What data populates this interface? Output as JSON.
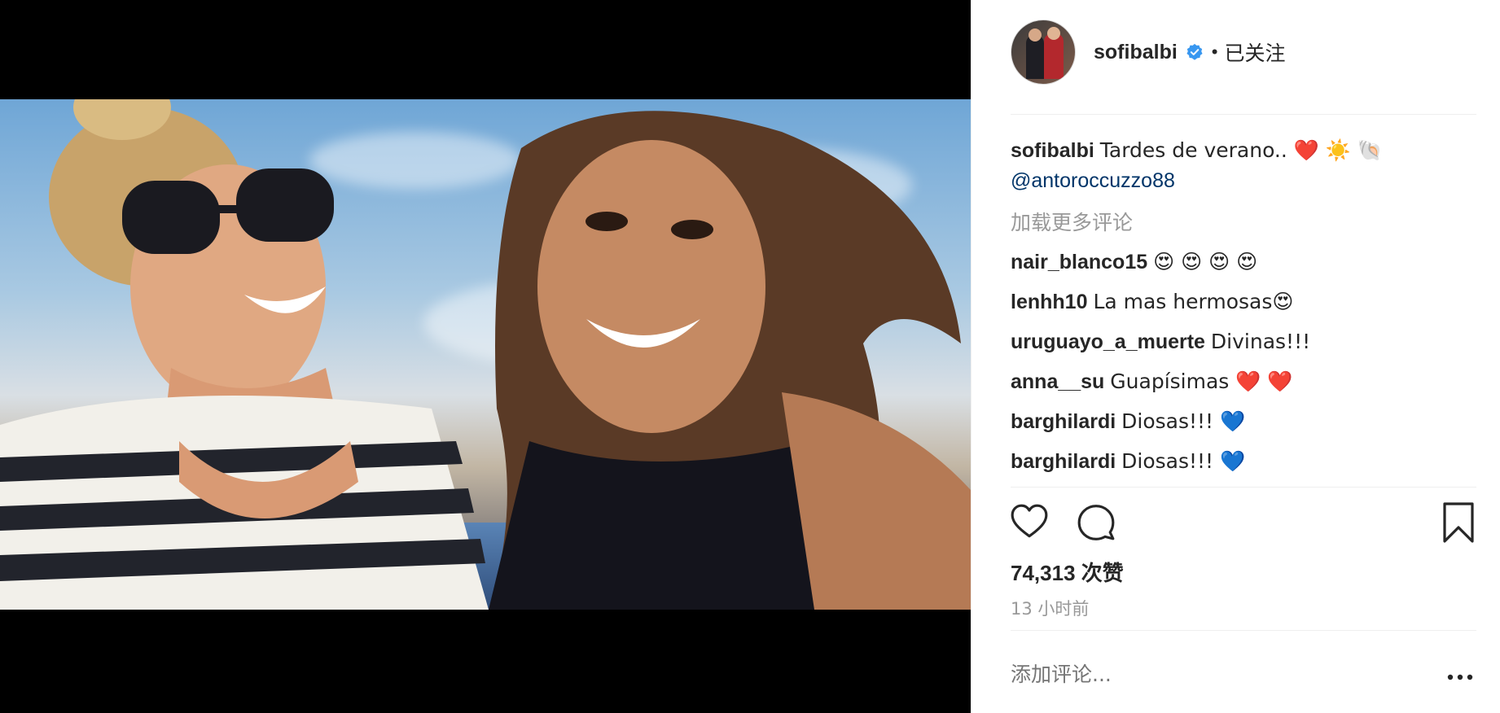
{
  "post": {
    "username": "sofibalbi",
    "dot": "•",
    "follow_status": "已关注",
    "caption": {
      "username": "sofibalbi",
      "text": "Tardes de verano.. ❤️ ☀️ 🐚",
      "mention": "@antoroccuzzo88"
    },
    "load_more": "加载更多评论",
    "comments": [
      {
        "user": "nair_blanco15",
        "text": "😍 😍 😍 😍"
      },
      {
        "user": "lenhh10",
        "text": "La mas hermosas😍"
      },
      {
        "user": "uruguayo_a_muerte",
        "text": "Divinas!!!"
      },
      {
        "user": "anna__su",
        "text": "Guapísimas ❤️ ❤️"
      },
      {
        "user": "barghilardi",
        "text": "Diosas!!! 💙"
      },
      {
        "user": "barghilardi",
        "text": "Diosas!!! 💙"
      }
    ],
    "likes_count": "74,313",
    "likes_unit": "次赞",
    "time_ago": "13 小时前",
    "add_comment_placeholder": "添加评论..."
  },
  "icons": {
    "verified": "verified-badge-icon",
    "like": "heart-icon",
    "comment": "comment-bubble-icon",
    "save": "bookmark-icon",
    "options": "more-options-icon"
  },
  "colors": {
    "verified_blue": "#3897f0",
    "mention": "#003569",
    "muted": "#999999",
    "text": "#262626",
    "divider": "#efefef"
  }
}
